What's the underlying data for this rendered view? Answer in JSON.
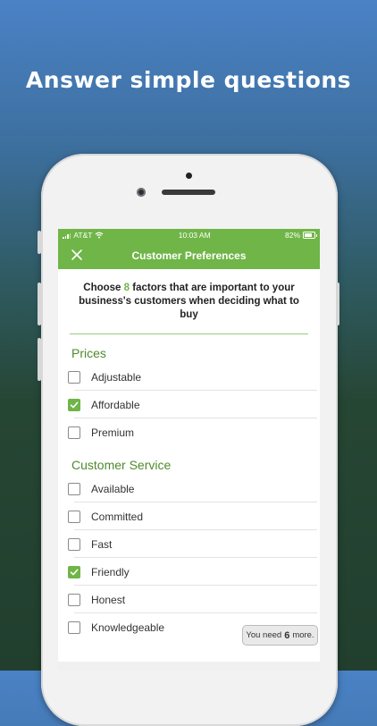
{
  "headline": "Answer simple questions",
  "status_bar": {
    "carrier": "AT&T",
    "time": "10:03 AM",
    "battery": "82%"
  },
  "nav": {
    "title": "Customer Preferences"
  },
  "prompt": {
    "before": "Choose",
    "count": "8",
    "after": "factors that are important to your business's customers when deciding what to buy"
  },
  "sections": [
    {
      "title": "Prices",
      "options": [
        {
          "label": "Adjustable",
          "checked": false
        },
        {
          "label": "Affordable",
          "checked": true
        },
        {
          "label": "Premium",
          "checked": false
        }
      ]
    },
    {
      "title": "Customer Service",
      "options": [
        {
          "label": "Available",
          "checked": false
        },
        {
          "label": "Committed",
          "checked": false
        },
        {
          "label": "Fast",
          "checked": false
        },
        {
          "label": "Friendly",
          "checked": true
        },
        {
          "label": "Honest",
          "checked": false
        },
        {
          "label": "Knowledgeable",
          "checked": false
        }
      ]
    }
  ],
  "footer": {
    "need_prefix": "You need",
    "need_count": "6",
    "need_suffix": "more."
  },
  "colors": {
    "accent": "#6fb547",
    "section_title": "#4f8a2d"
  }
}
